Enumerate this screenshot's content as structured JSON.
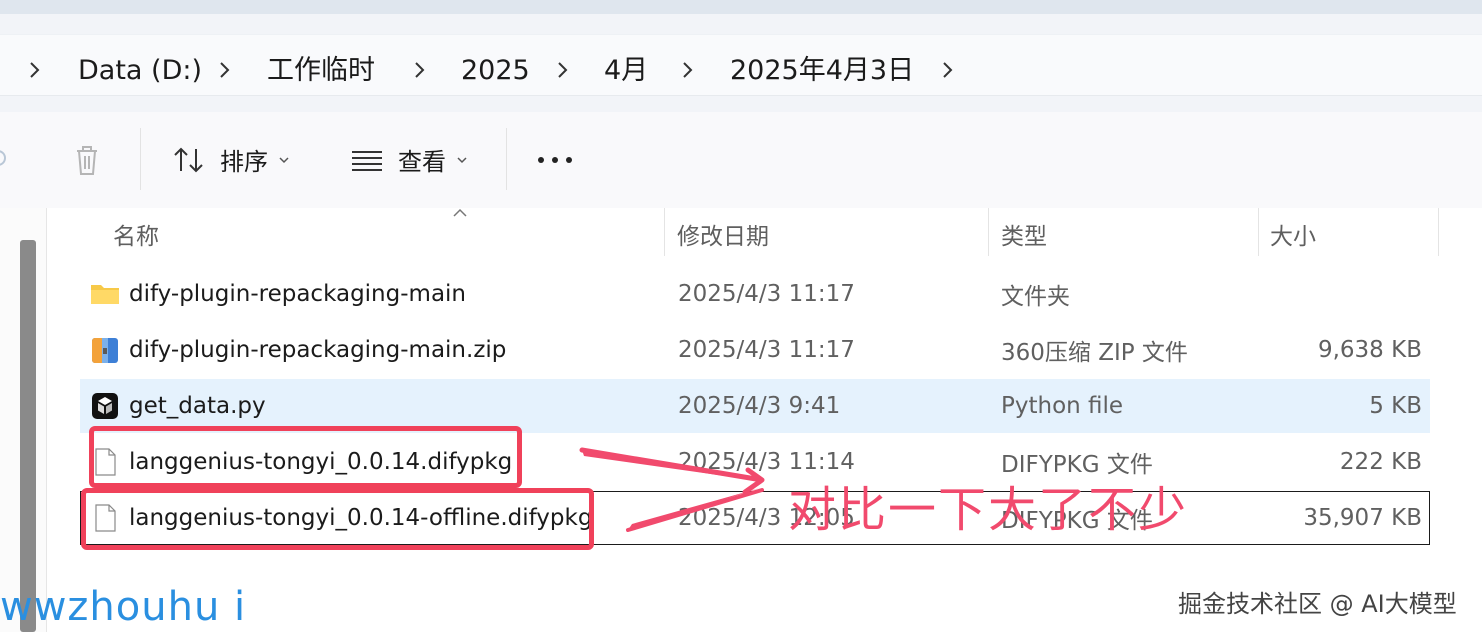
{
  "breadcrumb": {
    "items": [
      "Data (D:)",
      "工作临时",
      "2025",
      "4月",
      "2025年4月3日"
    ]
  },
  "toolbar": {
    "sort_label": "排序",
    "view_label": "查看",
    "more_label": "•••"
  },
  "columns": {
    "name": "名称",
    "date": "修改日期",
    "type": "类型",
    "size": "大小"
  },
  "files": [
    {
      "name": "dify-plugin-repackaging-main",
      "date": "2025/4/3 11:17",
      "type": "文件夹",
      "size": "",
      "icon": "folder-icon"
    },
    {
      "name": "dify-plugin-repackaging-main.zip",
      "date": "2025/4/3 11:17",
      "type": "360压缩 ZIP 文件",
      "size": "9,638 KB",
      "icon": "zip-archive-icon"
    },
    {
      "name": "get_data.py",
      "date": "2025/4/3 9:41",
      "type": "Python file",
      "size": "5 KB",
      "icon": "python-file-icon"
    },
    {
      "name": "langgenius-tongyi_0.0.14.difypkg",
      "date": "2025/4/3 11:14",
      "type": "DIFYPKG 文件",
      "size": "222 KB",
      "icon": "file-icon"
    },
    {
      "name": "langgenius-tongyi_0.0.14-offline.difypkg",
      "date": "2025/4/3 12:05",
      "type": "DIFYPKG 文件",
      "size": "35,907 KB",
      "icon": "file-icon"
    }
  ],
  "annotation": {
    "text": "对比一下大了不少",
    "color": "#f14a6d"
  },
  "watermarks": {
    "left": "wwzhouhu i",
    "right": "掘金技术社区 @ AI大模型"
  }
}
